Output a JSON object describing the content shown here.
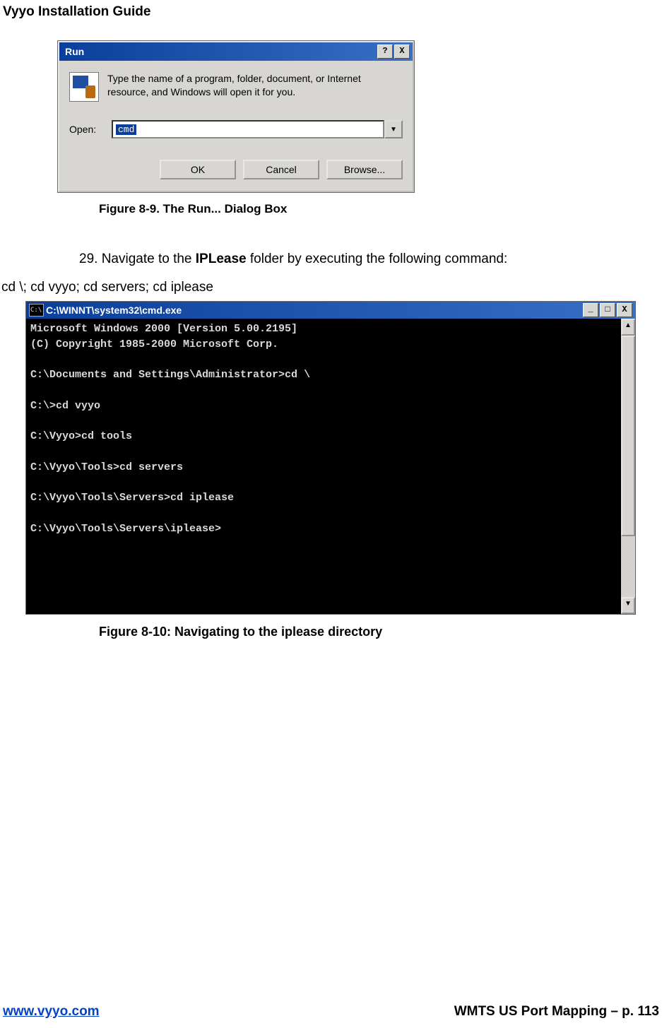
{
  "header": {
    "title": "Vyyo Installation Guide"
  },
  "run": {
    "title": "Run",
    "help_btn": "?",
    "close_btn": "X",
    "desc": "Type the name of a program, folder, document, or Internet resource, and Windows will open it for you.",
    "open_label": "Open:",
    "input_value": "cmd",
    "dropdown_arrow": "▼",
    "ok": "OK",
    "cancel": "Cancel",
    "browse": "Browse..."
  },
  "fig1": {
    "caption": "Figure 8-9. The Run... Dialog Box"
  },
  "step": {
    "prefix": "29. Navigate to the ",
    "bold": "IPLease",
    "suffix": " folder by executing the following command:"
  },
  "command": "cd \\; cd vyyo; cd servers; cd iplease",
  "cmd": {
    "icon": "C:\\",
    "title": "C:\\WINNT\\system32\\cmd.exe",
    "minimize": "_",
    "maximize": "□",
    "close": "X",
    "scroll_up": "▲",
    "scroll_down": "▼",
    "output": "Microsoft Windows 2000 [Version 5.00.2195]\n(C) Copyright 1985-2000 Microsoft Corp.\n\nC:\\Documents and Settings\\Administrator>cd \\\n\nC:\\>cd vyyo\n\nC:\\Vyyo>cd tools\n\nC:\\Vyyo\\Tools>cd servers\n\nC:\\Vyyo\\Tools\\Servers>cd iplease\n\nC:\\Vyyo\\Tools\\Servers\\iplease>"
  },
  "fig2": {
    "caption": "Figure 8-10: Navigating to the iplease directory"
  },
  "footer": {
    "left": "www.vyyo.com",
    "right": "WMTS US Port Mapping – p. 113"
  }
}
